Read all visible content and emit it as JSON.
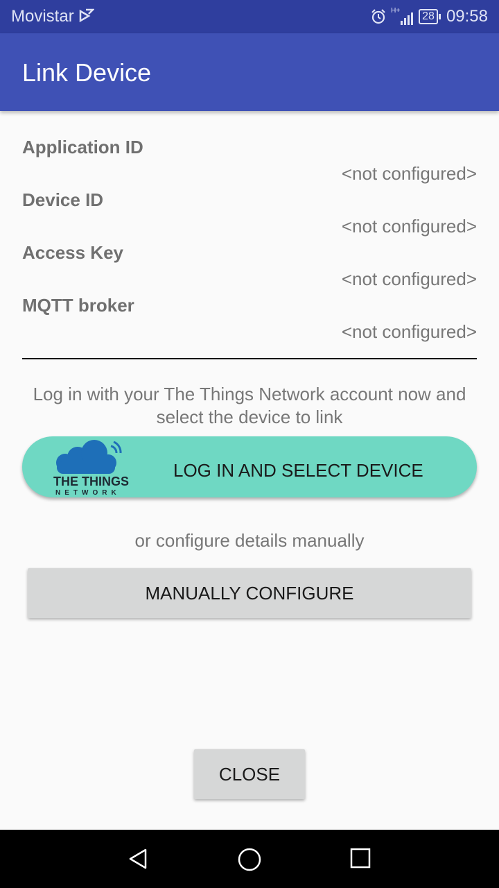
{
  "status_bar": {
    "carrier": "Movistar",
    "network_type": "H+",
    "battery": "28",
    "time": "09:58",
    "icons": [
      "carrier-signal-icon",
      "alarm-icon",
      "mobile-signal-icon",
      "battery-icon"
    ]
  },
  "app_bar": {
    "title": "Link Device"
  },
  "fields": [
    {
      "label": "Application ID",
      "value": "<not configured>"
    },
    {
      "label": "Device ID",
      "value": "<not configured>"
    },
    {
      "label": "Access Key",
      "value": "<not configured>"
    },
    {
      "label": "MQTT broker",
      "value": "<not configured>"
    }
  ],
  "login": {
    "instruction": "Log in with your The Things Network account now and select the device to link",
    "button_label": "LOG IN AND SELECT DEVICE",
    "logo_text": "THE THINGS",
    "logo_subtext": "NETWORK"
  },
  "manual": {
    "instruction": "or configure details manually",
    "button_label": "MANUALLY CONFIGURE"
  },
  "close_label": "CLOSE",
  "nav": {
    "icons": [
      "back-icon",
      "home-icon",
      "recents-icon"
    ]
  },
  "colors": {
    "status_bar": "#2f3e9e",
    "app_bar": "#3f51b5",
    "login_button": "#6fd8c3",
    "flat_button": "#d6d7d7",
    "logo_cloud": "#1e6fb8"
  }
}
